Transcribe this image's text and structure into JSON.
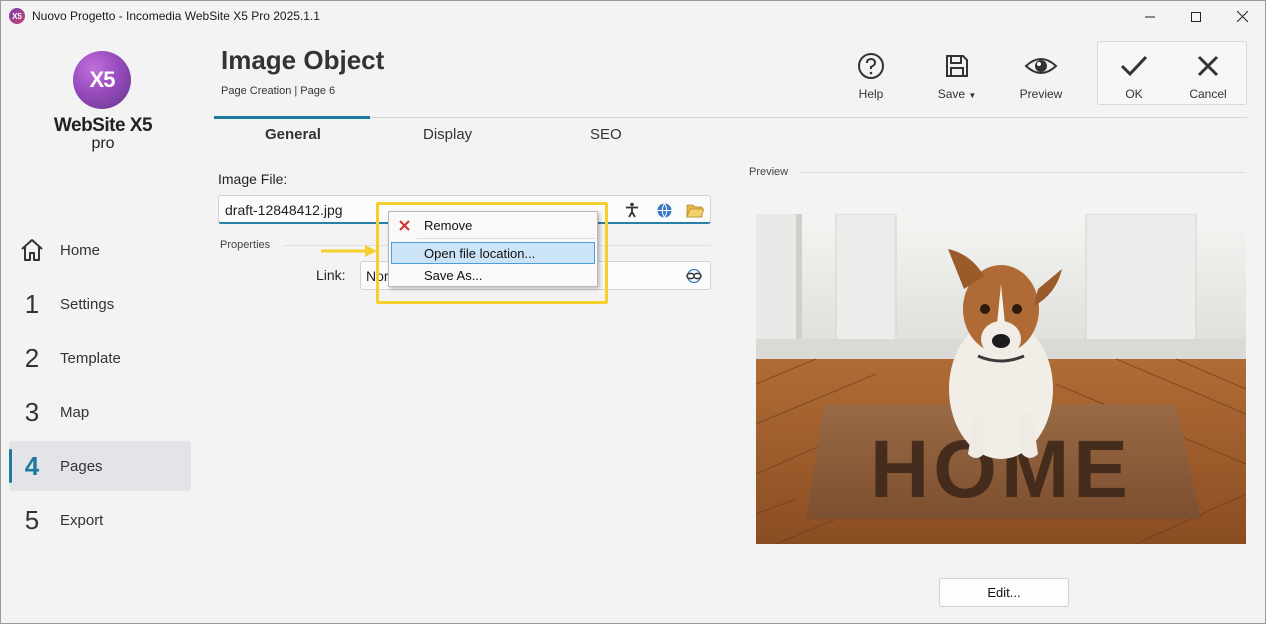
{
  "window": {
    "title": "Nuovo Progetto - Incomedia WebSite X5 Pro 2025.1.1",
    "app_icon_text": "X5",
    "controls": {
      "minimize": "—",
      "maximize": "☐",
      "close": "✕"
    }
  },
  "logo": {
    "badge": "X5",
    "name": "WebSite X5",
    "edition": "pro"
  },
  "sidebar": {
    "items": [
      {
        "num": "",
        "label": "Home"
      },
      {
        "num": "1",
        "label": "Settings"
      },
      {
        "num": "2",
        "label": "Template"
      },
      {
        "num": "3",
        "label": "Map"
      },
      {
        "num": "4",
        "label": "Pages"
      },
      {
        "num": "5",
        "label": "Export"
      }
    ],
    "active": "Pages"
  },
  "header": {
    "title": "Image Object",
    "breadcrumb": "Page Creation | Page 6"
  },
  "toolbar": {
    "help": "Help",
    "save": "Save",
    "preview": "Preview",
    "ok": "OK",
    "cancel": "Cancel"
  },
  "tabs": [
    {
      "label": "General",
      "active": true
    },
    {
      "label": "Display",
      "active": false
    },
    {
      "label": "SEO",
      "active": false
    }
  ],
  "form": {
    "image_file_label": "Image File:",
    "image_file_value": "draft-12848412.jpg",
    "properties_label": "Properties",
    "link_label": "Link:",
    "link_value": "Nor"
  },
  "context_menu": {
    "items": [
      {
        "label": "Remove",
        "icon": "red-x-icon"
      },
      {
        "label": "Open file location...",
        "highlighted": true
      },
      {
        "label": "Save As..."
      }
    ]
  },
  "preview": {
    "label": "Preview",
    "mat_text": "HOME",
    "edit_button": "Edit..."
  },
  "colors": {
    "accent": "#1b7a9e",
    "highlight_box": "#f5d02c",
    "menu_highlight": "#cce4f7"
  }
}
